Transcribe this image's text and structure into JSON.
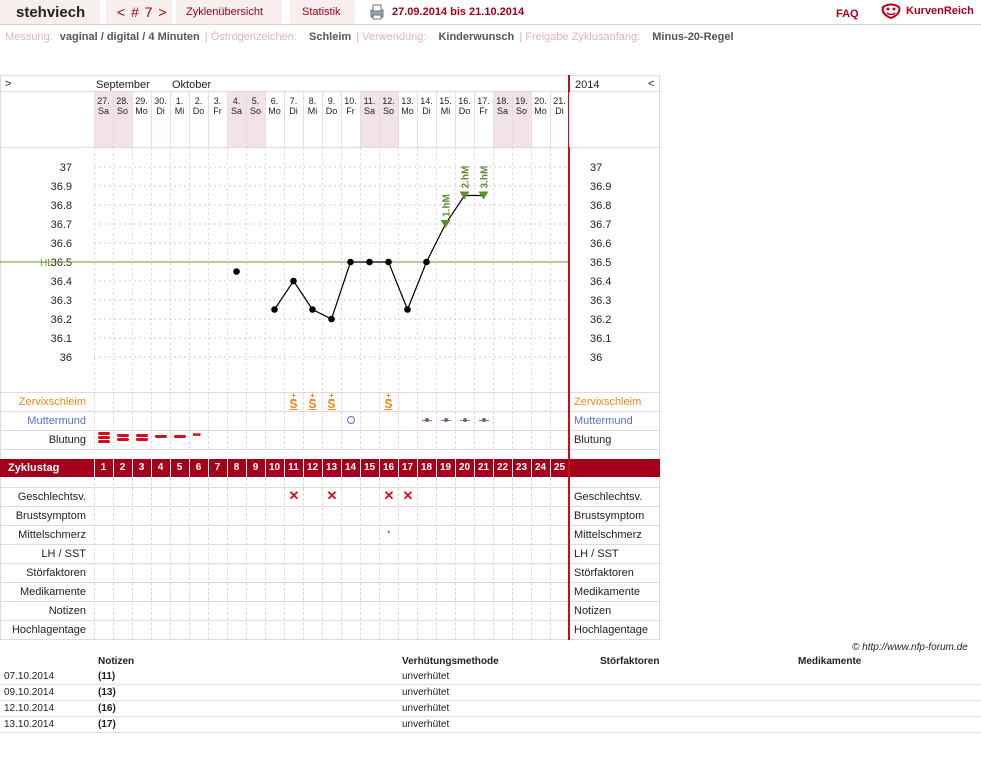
{
  "header": {
    "username": "stehviech",
    "cycle_nav": "< # 7 >",
    "tab_overview": "Zyklenübersicht",
    "tab_statistics": "Statistik",
    "date_range": "27.09.2014 bis 21.10.2014",
    "faq": "FAQ",
    "logo_text": "KurvenReich"
  },
  "settings": {
    "measurement_label": "Messung:",
    "measurement_value": "vaginal / digital / 4 Minuten",
    "estrogen_label": "Östrogenzeichen:",
    "estrogen_value": "Schleim",
    "usage_label": "Verwendung:",
    "usage_value": "Kinderwunsch",
    "release_label": "Freigabe Zyklusanfang:",
    "release_value": "Minus-20-Regel"
  },
  "chart_nav": {
    "left": ">",
    "right": "<",
    "year": "2014",
    "month1": "September",
    "month2": "Oktober"
  },
  "days": [
    {
      "d": "27.",
      "w": "Sa",
      "we": true
    },
    {
      "d": "28.",
      "w": "So",
      "we": true
    },
    {
      "d": "29.",
      "w": "Mo",
      "we": false
    },
    {
      "d": "30.",
      "w": "Di",
      "we": false
    },
    {
      "d": "1.",
      "w": "Mi",
      "we": false
    },
    {
      "d": "2.",
      "w": "Do",
      "we": false
    },
    {
      "d": "3.",
      "w": "Fr",
      "we": false
    },
    {
      "d": "4.",
      "w": "Sa",
      "we": true
    },
    {
      "d": "5.",
      "w": "So",
      "we": true
    },
    {
      "d": "6.",
      "w": "Mo",
      "we": false
    },
    {
      "d": "7.",
      "w": "Di",
      "we": false
    },
    {
      "d": "8.",
      "w": "Mi",
      "we": false
    },
    {
      "d": "9.",
      "w": "Do",
      "we": false
    },
    {
      "d": "10.",
      "w": "Fr",
      "we": false
    },
    {
      "d": "11.",
      "w": "Sa",
      "we": true
    },
    {
      "d": "12.",
      "w": "So",
      "we": true
    },
    {
      "d": "13.",
      "w": "Mo",
      "we": false
    },
    {
      "d": "14.",
      "w": "Di",
      "we": false
    },
    {
      "d": "15.",
      "w": "Mi",
      "we": false
    },
    {
      "d": "16.",
      "w": "Do",
      "we": false
    },
    {
      "d": "17.",
      "w": "Fr",
      "we": false
    },
    {
      "d": "18.",
      "w": "Sa",
      "we": true
    },
    {
      "d": "19.",
      "w": "So",
      "we": true
    },
    {
      "d": "20.",
      "w": "Mo",
      "we": false
    },
    {
      "d": "21.",
      "w": "Di",
      "we": false
    }
  ],
  "chart_data": {
    "type": "line",
    "y_ticks": [
      "37",
      "36.9",
      "36.8",
      "36.7",
      "36.6",
      "36.5",
      "36.4",
      "36.3",
      "36.2",
      "36.1",
      "36"
    ],
    "ylim": [
      36.0,
      37.0
    ],
    "hl_label": "HL",
    "hl_value": 36.5,
    "isolated_points": [
      {
        "day": 8,
        "y": 36.45
      }
    ],
    "series": [
      {
        "points": [
          {
            "day": 10,
            "y": 36.25
          },
          {
            "day": 11,
            "y": 36.4
          },
          {
            "day": 12,
            "y": 36.25
          },
          {
            "day": 13,
            "y": 36.2
          },
          {
            "day": 14,
            "y": 36.5
          },
          {
            "day": 15,
            "y": 36.5
          },
          {
            "day": 16,
            "y": 36.5
          },
          {
            "day": 17,
            "y": 36.25
          },
          {
            "day": 18,
            "y": 36.5
          },
          {
            "day": 19,
            "y": 36.7
          },
          {
            "day": 20,
            "y": 36.85
          },
          {
            "day": 21,
            "y": 36.85
          }
        ]
      }
    ],
    "markers": [
      {
        "day": 19,
        "label": "1.hM"
      },
      {
        "day": 20,
        "label": "2.hM"
      },
      {
        "day": 21,
        "label": "3.hM"
      }
    ]
  },
  "rows": {
    "zervix": "Zervixschleim",
    "muttermund": "Muttermund",
    "blutung": "Blutung",
    "zyklustag": "Zyklustag",
    "gv": "Geschlechtsv.",
    "brust": "Brustsymptom",
    "mittel": "Mittelschmerz",
    "lh": "LH / SST",
    "stoer": "Störfaktoren",
    "medi": "Medikamente",
    "notiz": "Notizen",
    "hoch": "Hochlagentage"
  },
  "zervix_days": [
    11,
    12,
    13,
    16
  ],
  "zervix_symbol": "S",
  "mm_days": [
    18,
    19,
    20,
    21
  ],
  "gv_days": [
    11,
    13,
    16,
    17
  ],
  "mittel_day": 16,
  "colors": {
    "accent": "#a4001c",
    "zervix": "#e8891a",
    "muttermund": "#5a6fcb",
    "grid": "#e6d6d8",
    "weekend": "#f1e3e6",
    "hl": "#6f9a35"
  },
  "copyright": "© http://www.nfp-forum.de",
  "notes": {
    "headers": [
      "Notizen",
      "Verhütungsmethode",
      "Störfaktoren",
      "Medikamente"
    ],
    "rows": [
      {
        "date": "07.10.2014",
        "day": "(11)",
        "method": "unverhütet"
      },
      {
        "date": "09.10.2014",
        "day": "(13)",
        "method": "unverhütet"
      },
      {
        "date": "12.10.2014",
        "day": "(16)",
        "method": "unverhütet"
      },
      {
        "date": "13.10.2014",
        "day": "(17)",
        "method": "unverhütet"
      }
    ]
  }
}
